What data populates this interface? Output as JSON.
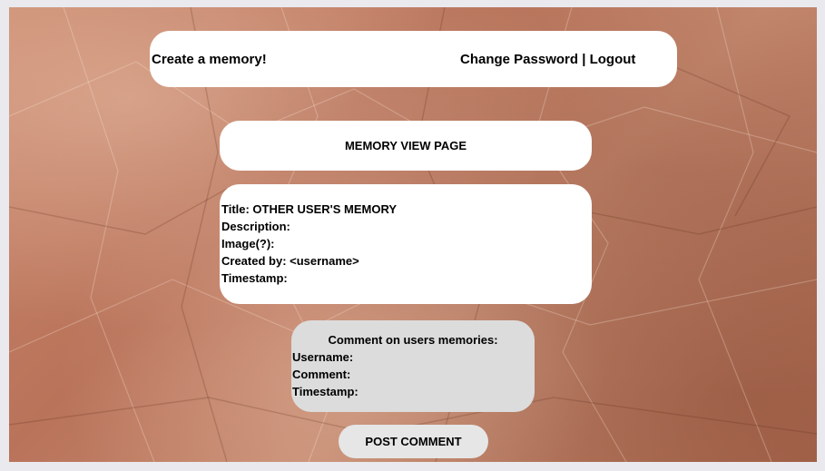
{
  "navbar": {
    "create_link": "Create a memory!",
    "change_password_link": "Change Password",
    "separator": " | ",
    "logout_link": "Logout"
  },
  "page_title": "MEMORY VIEW PAGE",
  "memory": {
    "title_line": "Title: OTHER USER'S MEMORY",
    "description_line": "Description:",
    "image_line": "Image(?):",
    "created_by_line": "Created by: <username>",
    "timestamp_line": "Timestamp:"
  },
  "comment": {
    "heading": "Comment on users memories:",
    "username_line": "Username:",
    "comment_line": "Comment:",
    "timestamp_line": "Timestamp:"
  },
  "post_button_label": "POST COMMENT",
  "colors": {
    "paper_background": "#b9735a",
    "panel": "#ffffff",
    "comment_panel": "#dcdcdc",
    "button": "#e6e6e6"
  }
}
